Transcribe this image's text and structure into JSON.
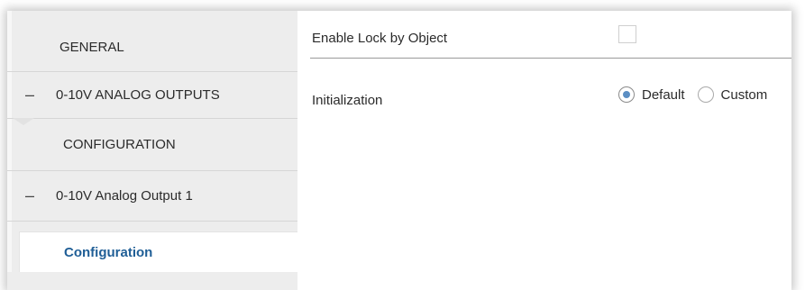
{
  "sidebar": {
    "items": [
      {
        "label": "GENERAL"
      },
      {
        "label": "0-10V ANALOG OUTPUTS",
        "expander": "–"
      },
      {
        "label": "CONFIGURATION"
      },
      {
        "label": "0-10V Analog Output 1",
        "expander": "–"
      },
      {
        "label": "Configuration",
        "selected": true
      }
    ]
  },
  "main": {
    "lock": {
      "label": "Enable Lock by Object",
      "checked": false
    },
    "initialization": {
      "label": "Initialization",
      "options": [
        {
          "label": "Default",
          "checked": true
        },
        {
          "label": "Custom",
          "checked": false
        }
      ]
    }
  },
  "colors": {
    "selected_text": "#1f5e96",
    "radio_fill": "#5b8ec3",
    "sidebar_bg": "#ededed"
  }
}
